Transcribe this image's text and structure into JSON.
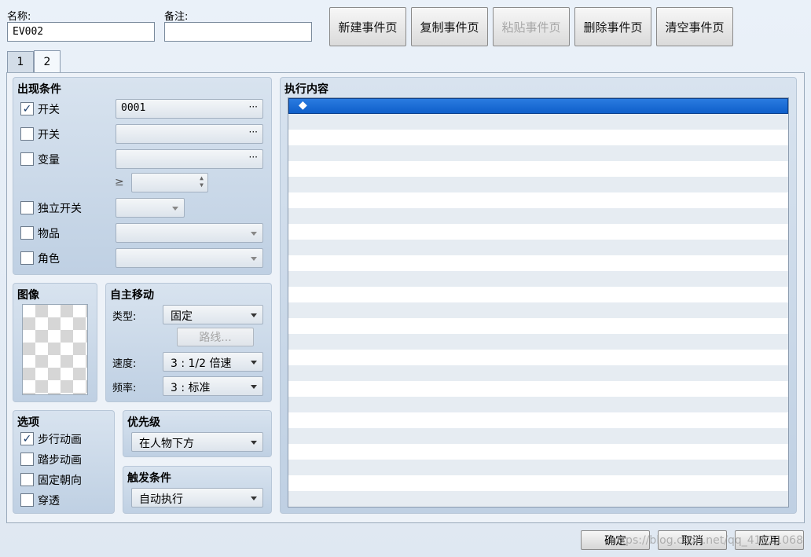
{
  "header": {
    "name_label": "名称:",
    "name_value": "EV002",
    "note_label": "备注:",
    "note_value": ""
  },
  "toolbar": {
    "new_page": "新建事件页",
    "copy_page": "复制事件页",
    "paste_page": "粘贴事件页",
    "delete_page": "删除事件页",
    "clear_page": "清空事件页"
  },
  "tabs": [
    {
      "label": "1"
    },
    {
      "label": "2",
      "active": true
    }
  ],
  "conditions": {
    "title": "出现条件",
    "switch1": {
      "label": "开关",
      "checked": true,
      "value": "0001"
    },
    "switch2": {
      "label": "开关",
      "checked": false,
      "value": ""
    },
    "variable": {
      "label": "变量",
      "checked": false,
      "value": ""
    },
    "gte_symbol": "≥",
    "self_switch": {
      "label": "独立开关",
      "checked": false
    },
    "item": {
      "label": "物品",
      "checked": false
    },
    "actor": {
      "label": "角色",
      "checked": false
    },
    "dots": "···"
  },
  "image": {
    "title": "图像"
  },
  "autonomous": {
    "title": "自主移动",
    "type_label": "类型:",
    "type_value": "固定",
    "route_button": "路线...",
    "speed_label": "速度:",
    "speed_value": "3 : 1/2 倍速",
    "freq_label": "频率:",
    "freq_value": "3 : 标准"
  },
  "options": {
    "title": "选项",
    "items": [
      {
        "label": "步行动画",
        "checked": true
      },
      {
        "label": "踏步动画",
        "checked": false
      },
      {
        "label": "固定朝向",
        "checked": false
      },
      {
        "label": "穿透",
        "checked": false
      }
    ]
  },
  "priority": {
    "title": "优先级",
    "value": "在人物下方"
  },
  "trigger": {
    "title": "触发条件",
    "value": "自动执行"
  },
  "contents": {
    "title": "执行内容",
    "first_row": "◆"
  },
  "footer": {
    "ok": "确定",
    "cancel": "取消",
    "apply": "应用",
    "watermark": "https://blog.csdn.net/qq_41521068"
  }
}
